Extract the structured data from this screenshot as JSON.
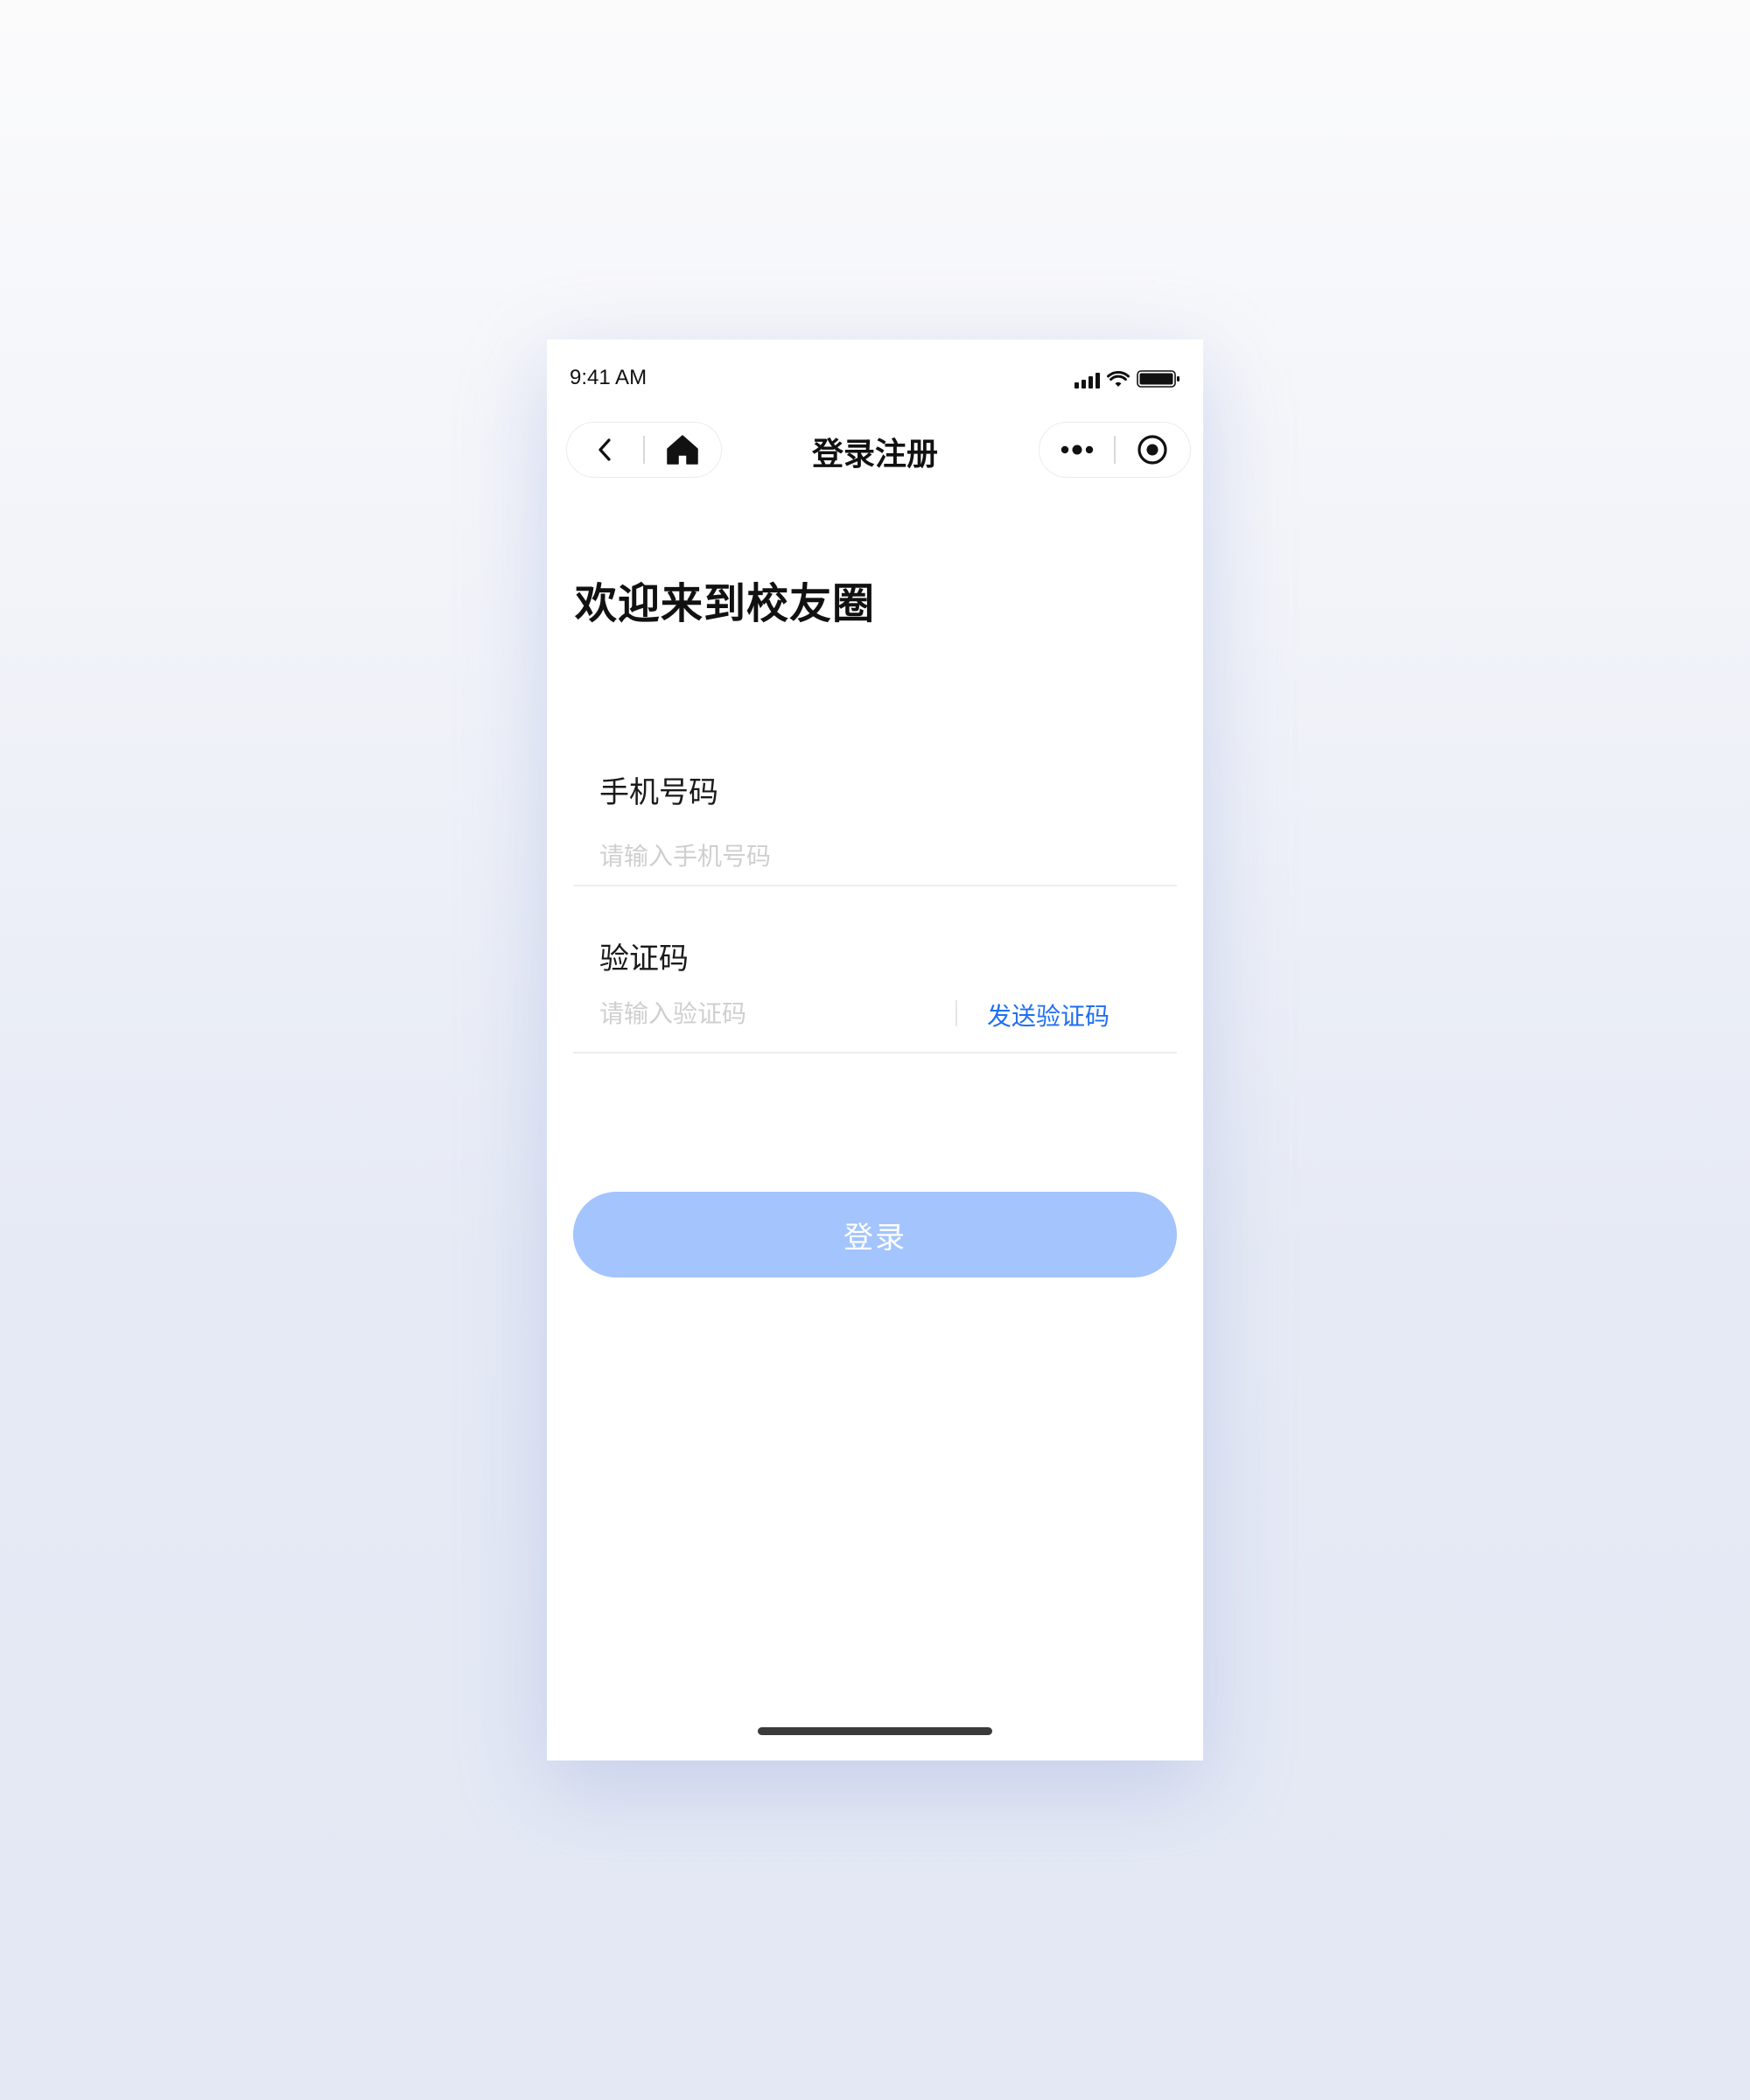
{
  "status_bar": {
    "time": "9:41 AM"
  },
  "nav": {
    "title": "登录注册"
  },
  "welcome_title": "欢迎来到校友圈",
  "phone_field": {
    "label": "手机号码",
    "placeholder": "请输入手机号码",
    "value": ""
  },
  "code_field": {
    "label": "验证码",
    "placeholder": "请输入验证码",
    "value": "",
    "send_label": "发送验证码"
  },
  "login_button": {
    "label": "登录"
  },
  "icons": {
    "back": "chevron-left-icon",
    "home": "home-icon",
    "more": "more-dots-icon",
    "close": "target-circle-icon",
    "signal": "signal-icon",
    "wifi": "wifi-icon",
    "battery": "battery-icon"
  },
  "colors": {
    "accent": "#1f6ff2",
    "button_disabled": "#a3c4fd",
    "placeholder": "#cfcfcf",
    "text": "#111111"
  }
}
